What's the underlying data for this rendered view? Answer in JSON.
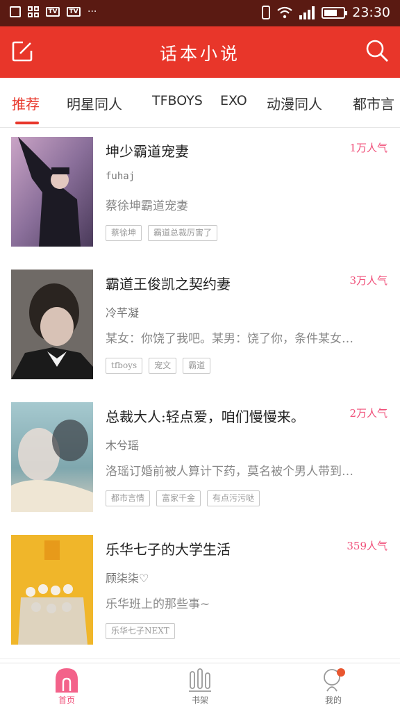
{
  "status_bar": {
    "time": "23:30",
    "overflow": "···"
  },
  "header": {
    "title": "话本小说",
    "edit_icon": "edit-icon",
    "search_icon": "search-icon"
  },
  "tabs": [
    {
      "label": "推荐",
      "active": true
    },
    {
      "label": "明星同人",
      "active": false
    },
    {
      "label": "TFBOYS",
      "active": false
    },
    {
      "label": "EXO",
      "active": false
    },
    {
      "label": "动漫同人",
      "active": false
    },
    {
      "label": "都市言",
      "active": false
    }
  ],
  "books": [
    {
      "title": "坤少霸道宠妻",
      "popularity": "1万人气",
      "author": "fuhaj",
      "description": "蔡徐坤霸道宠妻",
      "tags": [
        "蔡徐坤",
        "霸道总裁厉害了"
      ]
    },
    {
      "title": "霸道王俊凯之契约妻",
      "popularity": "3万人气",
      "author": "冷芊凝",
      "description": "某女：你饶了我吧。某男：饶了你，条件某女…",
      "tags": [
        "tfboys",
        "宠文",
        "霸道"
      ]
    },
    {
      "title": "总裁大人:轻点爱，咱们慢慢来。",
      "popularity": "2万人气",
      "author": "木兮瑶",
      "description": "洛瑶订婚前被人算计下药，莫名被个男人带到…",
      "tags": [
        "都市言情",
        "富家千金",
        "有点污污哒"
      ]
    },
    {
      "title": "乐华七子的大学生活",
      "popularity": "359人气",
      "author": "顾柒柒♡",
      "description": "乐华班上的那些事~",
      "tags": [
        "乐华七子NEXT"
      ]
    }
  ],
  "bottom_nav": [
    {
      "label": "首页",
      "icon": "home-icon",
      "active": true
    },
    {
      "label": "书架",
      "icon": "bookshelf-icon",
      "active": false
    },
    {
      "label": "我的",
      "icon": "profile-icon",
      "active": false
    }
  ],
  "colors": {
    "accent": "#e8362a",
    "popularity": "#f0507a",
    "status_bar": "#5a1a12"
  }
}
